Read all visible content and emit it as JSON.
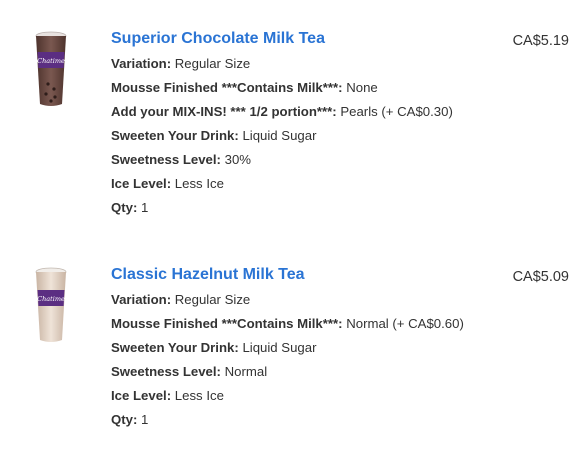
{
  "colors": {
    "product_name": "#2a74d4",
    "text": "#333333",
    "cup_chocolate": "#6b4a42",
    "cup_hazelnut": "#d9c7b8",
    "brand_band": "#5b2e82"
  },
  "items": [
    {
      "image": "chocolate-milk-tea-cup-icon",
      "name": "Superior Chocolate Milk Tea",
      "price": "CA$5.19",
      "details": [
        {
          "label": "Variation:",
          "value": "Regular Size"
        },
        {
          "label": "Mousse Finished ***Contains Milk***:",
          "value": "None"
        },
        {
          "label": "Add your MIX-INS! *** 1/2 portion***:",
          "value": "Pearls (+ CA$0.30)"
        },
        {
          "label": "Sweeten Your Drink:",
          "value": "Liquid Sugar"
        },
        {
          "label": "Sweetness Level:",
          "value": "30%"
        },
        {
          "label": "Ice Level:",
          "value": "Less Ice"
        },
        {
          "label": "Qty:",
          "value": "1"
        }
      ]
    },
    {
      "image": "hazelnut-milk-tea-cup-icon",
      "name": "Classic Hazelnut Milk Tea",
      "price": "CA$5.09",
      "details": [
        {
          "label": "Variation:",
          "value": "Regular Size"
        },
        {
          "label": "Mousse Finished ***Contains Milk***:",
          "value": "Normal (+ CA$0.60)"
        },
        {
          "label": "Sweeten Your Drink:",
          "value": "Liquid Sugar"
        },
        {
          "label": "Sweetness Level:",
          "value": "Normal"
        },
        {
          "label": "Ice Level:",
          "value": "Less Ice"
        },
        {
          "label": "Qty:",
          "value": "1"
        }
      ]
    }
  ]
}
